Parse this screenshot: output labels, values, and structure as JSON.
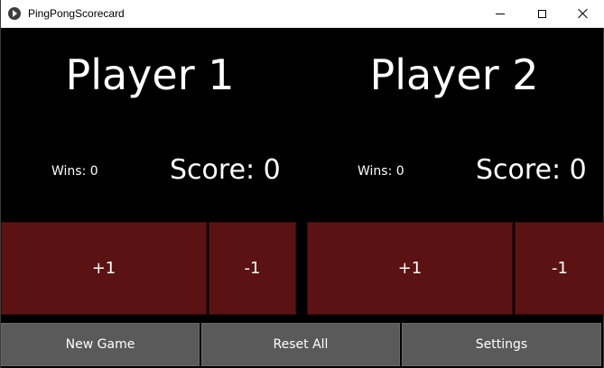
{
  "window": {
    "title": "PingPongScorecard",
    "controls": {
      "minimize": "minimize",
      "maximize": "maximize",
      "close": "close"
    }
  },
  "players": [
    {
      "name": "Player 1",
      "wins_label": "Wins: 0",
      "score_label": "Score: 0",
      "plus_label": "+1",
      "minus_label": "-1"
    },
    {
      "name": "Player 2",
      "wins_label": "Wins: 0",
      "score_label": "Score: 0",
      "plus_label": "+1",
      "minus_label": "-1"
    }
  ],
  "actions": {
    "new_game": "New Game",
    "reset_all": "Reset All",
    "settings": "Settings"
  },
  "colors": {
    "background": "#000000",
    "point_button": "#5b1213",
    "action_button": "#5a5a5a",
    "text": "#ffffff"
  }
}
